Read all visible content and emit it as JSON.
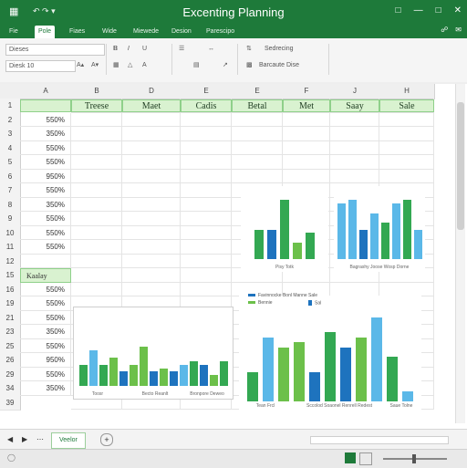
{
  "window": {
    "title": "Excenting Planning"
  },
  "ribbon_tabs": [
    "Fie",
    "Pole",
    "Fiaes",
    "Wide",
    "Miewede",
    "Desion",
    "Parescipo"
  ],
  "ribbon_tab_active": 1,
  "ribbon": {
    "font_name": "Dieses",
    "font_size": "Diesk 10",
    "style_label": "Sedrecing",
    "format_label": "Barcaute Dise"
  },
  "column_headers": [
    "A",
    "B",
    "D",
    "E",
    "E",
    "F",
    "J",
    "H"
  ],
  "row_numbers": [
    "1",
    "2",
    "3",
    "4",
    "5",
    "6",
    "7",
    "8",
    "9",
    "10",
    "11",
    "12",
    "15",
    "16",
    "19",
    "21",
    "23",
    "25",
    "26",
    "29",
    "34",
    "39"
  ],
  "table": {
    "header_row": [
      "Treese",
      "Maet",
      "Cadis",
      "Betal",
      "Met",
      "Saay",
      "Sale"
    ],
    "column_a_values": [
      "550%",
      "350%",
      "550%",
      "550%",
      "950%",
      "550%",
      "350%",
      "550%",
      "550%",
      "550%",
      "",
      "Kaalay",
      "550%",
      "550%",
      "550%",
      "350%",
      "550%",
      "950%",
      "550%",
      "350%"
    ]
  },
  "charts": {
    "c1": {
      "caption": "Pisy Totk"
    },
    "c2": {
      "caption": "Bagrashy Joose Wosp Dorne"
    },
    "c3": {
      "caption_left": "Toosr",
      "caption_mid": "Becto Reanlt",
      "caption_right": "Bronpore Deweo"
    },
    "c4": {
      "legend_1": "Favinnocke Bonl Manne Sale",
      "legend_2": "Bennie",
      "legend_3": "Sal",
      "caption_left": "Tean Frcl",
      "caption_mid": "Sccolod Soaonel Renrell Redest",
      "caption_right": "Saue Tolne"
    }
  },
  "chart_data": [
    {
      "type": "bar",
      "values": [
        0.45,
        0.45,
        0.9,
        0.25,
        0.4
      ]
    },
    {
      "type": "bar",
      "values": [
        0.85,
        0.9,
        0.45,
        0.7,
        0.55,
        0.85,
        0.9,
        0.45
      ]
    },
    {
      "type": "bar",
      "values": [
        0.3,
        0.5,
        0.3,
        0.4,
        0.2,
        0.3,
        0.55,
        0.2,
        0.25,
        0.2,
        0.3,
        0.35,
        0.3,
        0.15,
        0.35
      ]
    },
    {
      "type": "bar",
      "values": [
        0.3,
        0.65,
        0.55,
        0.6,
        0.3,
        0.7,
        0.55,
        0.65,
        0.85,
        0.45,
        0.1
      ]
    }
  ],
  "sheet_tabs": [
    "Veelor"
  ],
  "colors": {
    "brand": "#1e7a3a",
    "green_light": "#6cc04a",
    "green": "#33a852",
    "blue": "#1e73be",
    "sky": "#5bb8e8"
  }
}
